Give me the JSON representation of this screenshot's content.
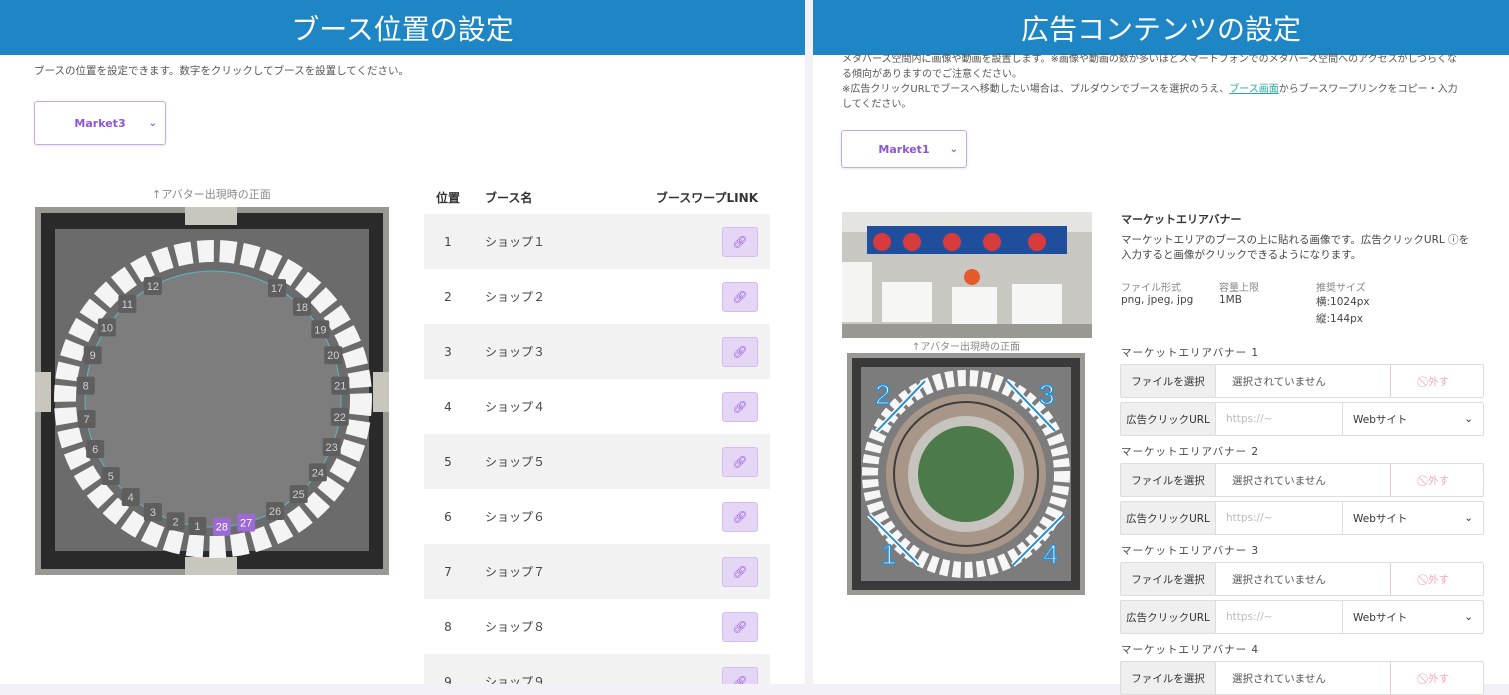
{
  "left": {
    "title": "ブース位置の設定",
    "description": "ブースの位置を設定できます。数字をクリックしてブースを設置してください。",
    "market_select": "Market3",
    "map_caption": "↑アバター出現時の正面",
    "table": {
      "headers": [
        "位置",
        "ブース名",
        "ブースワープLINK"
      ],
      "rows": [
        {
          "pos": "1",
          "name": "ショップ１"
        },
        {
          "pos": "2",
          "name": "ショップ２"
        },
        {
          "pos": "3",
          "name": "ショップ３"
        },
        {
          "pos": "4",
          "name": "ショップ４"
        },
        {
          "pos": "5",
          "name": "ショップ５"
        },
        {
          "pos": "6",
          "name": "ショップ６"
        },
        {
          "pos": "7",
          "name": "ショップ７"
        },
        {
          "pos": "8",
          "name": "ショップ８"
        },
        {
          "pos": "9",
          "name": "ショップ９"
        }
      ],
      "link_icon": "link-icon"
    },
    "seat_numbers": [
      "1",
      "2",
      "3",
      "4",
      "5",
      "6",
      "7",
      "8",
      "9",
      "10",
      "11",
      "12",
      "17",
      "18",
      "19",
      "20",
      "21",
      "22",
      "23",
      "24",
      "25",
      "26",
      "27",
      "28"
    ],
    "selected_seats": [
      "27",
      "28"
    ]
  },
  "right": {
    "title": "広告コンテンツの設定",
    "desc_line1": "メタバース空間内に画像や動画を設置します。※画像や動画の数が多いほどスマートフォンでのメタバース空間へのアクセスがしづらくな",
    "desc_line2": "る傾向がありますのでご注意ください。",
    "desc_line3_pre": "※広告クリックURLでブースへ移動したい場合は、プルダウンでブースを選択のうえ、",
    "desc_link": "ブース画面",
    "desc_line3_post": "からブースワープリンクをコピー・入力",
    "desc_line4": "してください。",
    "market_select": "Market1",
    "map_caption": "↑アバター出現時の正面",
    "corner_labels": [
      "1",
      "2",
      "3",
      "4"
    ],
    "section_title": "マーケットエリアバナー",
    "section_desc1": "マーケットエリアのブースの上に貼れる画像です。広告クリックURL ⓘを",
    "section_desc2": "入力すると画像がクリックできるようになります。",
    "meta": [
      {
        "label": "ファイル形式",
        "value": "png, jpeg, jpg"
      },
      {
        "label": "容量上限",
        "value": "1MB"
      },
      {
        "label": "推奨サイズ",
        "value": "横:1024px",
        "value2": "縦:144px"
      }
    ],
    "banners": [
      {
        "label": "マーケットエリアバナー 1",
        "file_btn": "ファイルを選択",
        "file_value": "選択されていません",
        "remove": "⃠ 外す",
        "url_label": "広告クリックURL",
        "url_placeholder": "https://~",
        "type": "Webサイト"
      },
      {
        "label": "マーケットエリアバナー 2",
        "file_btn": "ファイルを選択",
        "file_value": "選択されていません",
        "remove": "⃠ 外す",
        "url_label": "広告クリックURL",
        "url_placeholder": "https://~",
        "type": "Webサイト"
      },
      {
        "label": "マーケットエリアバナー 3",
        "file_btn": "ファイルを選択",
        "file_value": "選択されていません",
        "remove": "⃠ 外す",
        "url_label": "広告クリックURL",
        "url_placeholder": "https://~",
        "type": "Webサイト"
      },
      {
        "label": "マーケットエリアバナー 4",
        "file_btn": "ファイルを選択",
        "file_value": "選択されていません",
        "remove": "⃠ 外す"
      }
    ]
  }
}
